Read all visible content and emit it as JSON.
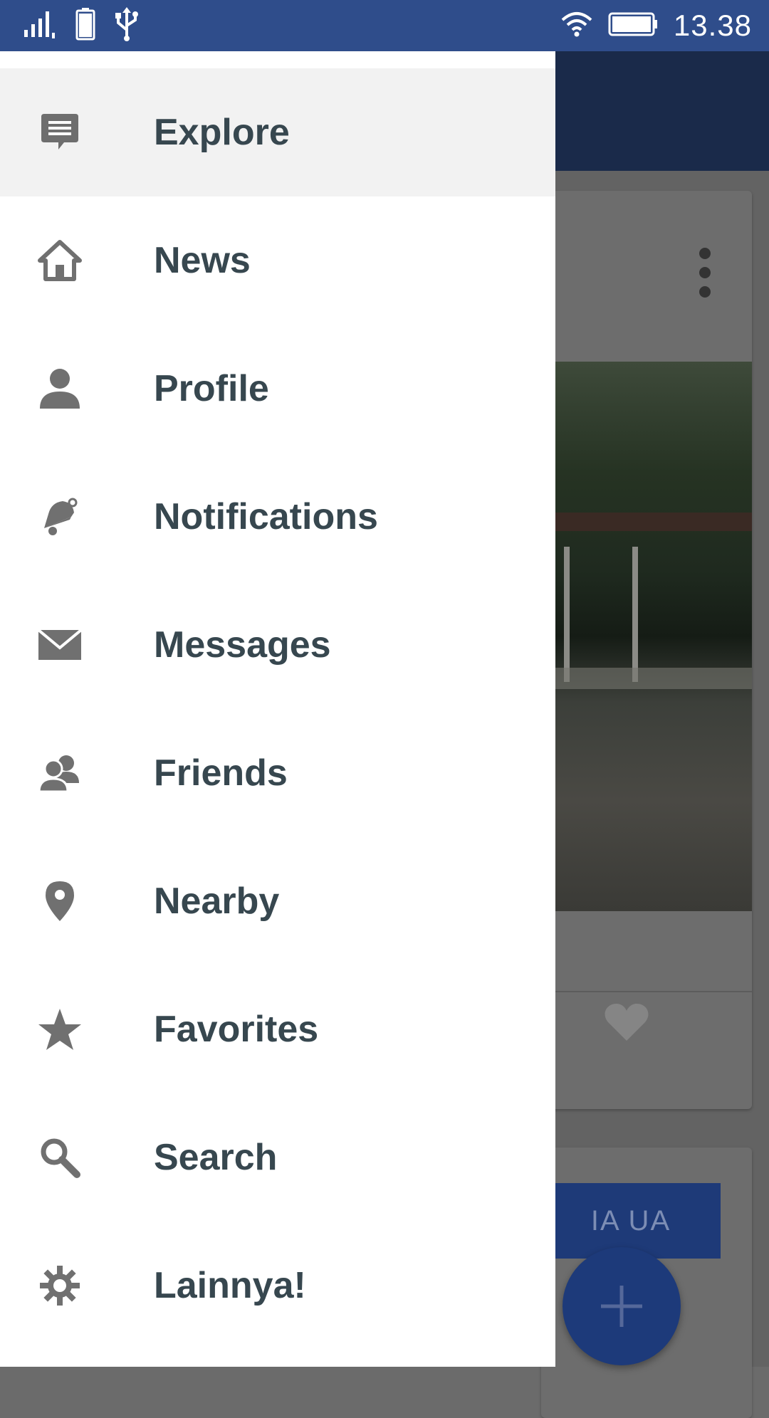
{
  "status_bar": {
    "time": "13.38",
    "battery_level": "100",
    "icons": [
      "signal-icon",
      "battery-icon",
      "usb-icon",
      "wifi-icon",
      "battery-outline-icon"
    ]
  },
  "drawer": {
    "items": [
      {
        "label": "Explore",
        "icon": "chat-bubble-icon",
        "active": true
      },
      {
        "label": "News",
        "icon": "home-icon",
        "active": false
      },
      {
        "label": "Profile",
        "icon": "person-icon",
        "active": false
      },
      {
        "label": "Notifications",
        "icon": "bell-icon",
        "active": false
      },
      {
        "label": "Messages",
        "icon": "envelope-icon",
        "active": false
      },
      {
        "label": "Friends",
        "icon": "people-icon",
        "active": false
      },
      {
        "label": "Nearby",
        "icon": "map-pin-icon",
        "active": false
      },
      {
        "label": "Favorites",
        "icon": "star-icon",
        "active": false
      },
      {
        "label": "Search",
        "icon": "magnifier-icon",
        "active": false
      },
      {
        "label": "Lainnya!",
        "icon": "gear-icon",
        "active": false
      }
    ]
  },
  "background": {
    "button_label": "IA   UA"
  },
  "colors": {
    "status_bar": "#2f4d8b",
    "drawer_text": "#37474f",
    "icon_gray": "#707070",
    "active_row": "#f2f2f2",
    "fab": "#1d3a7a"
  }
}
